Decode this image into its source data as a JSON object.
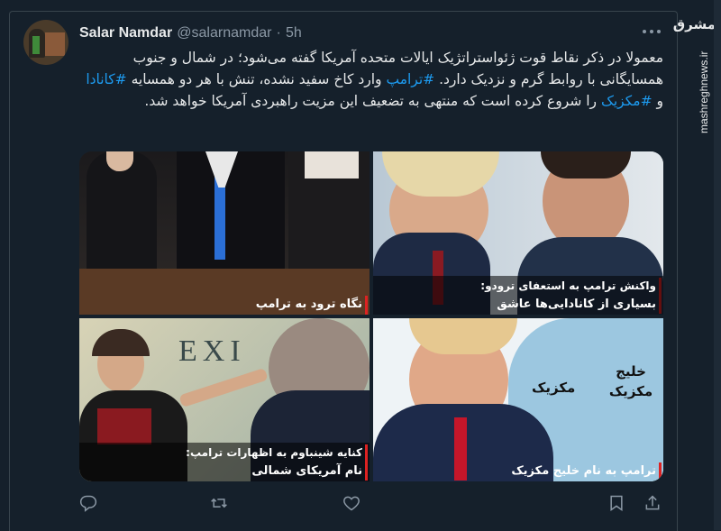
{
  "tweet": {
    "author_name": "Salar Namdar",
    "author_handle": "@salarnamdar",
    "separator": "·",
    "time": "5h",
    "more_icon": "more-horizontal-icon",
    "text_segments": [
      {
        "t": "معمولا در ذکر نقاط قوت ژئواستراتژیک ایالات متحده آمریکا گفته می‌شود؛ در شمال و جنوب همسایگانی با روابط گرم و نزدیک دارد. ",
        "tag": false
      },
      {
        "t": "#ترامپ",
        "tag": true
      },
      {
        "t": " وارد کاخ سفید نشده، تنش با هر دو همسایه ",
        "tag": false
      },
      {
        "t": "#کانادا",
        "tag": true
      },
      {
        "t": " و ",
        "tag": false
      },
      {
        "t": "#مکزیک",
        "tag": true
      },
      {
        "t": " را شروع کرده است که منتهی به تضعیف این مزیت راهبردی آمریکا خواهد شد.",
        "tag": false
      }
    ]
  },
  "images": [
    {
      "caption1": "",
      "caption2": "نگاه ترود به ترامپ"
    },
    {
      "caption1": "واکنش ترامپ به استعفای ترودو:",
      "caption2": "بسیاری از کانادایی‌ها عاشق"
    },
    {
      "caption1": "کنایه شینباوم به اظهارات ترامپ:",
      "caption2": "نام آمریکای شمالی"
    },
    {
      "caption1": "",
      "caption2": "ترامپ به نام خلیج مکزیک",
      "map_label_gulf": "خلیج مکزیک",
      "map_label_mexico": "مکزیک",
      "map_stamp": "EXI"
    }
  ],
  "actions": {
    "reply_icon": "reply-icon",
    "retweet_icon": "retweet-icon",
    "like_icon": "like-icon",
    "bookmark_icon": "bookmark-icon",
    "share_icon": "share-icon"
  },
  "watermark": {
    "logo": "مشرق",
    "url": "mashreghnews.ir"
  },
  "colors": {
    "background": "#15202b",
    "link": "#1d9bf0",
    "muted": "#8b98a5",
    "caption_accent": "#dd2222"
  }
}
